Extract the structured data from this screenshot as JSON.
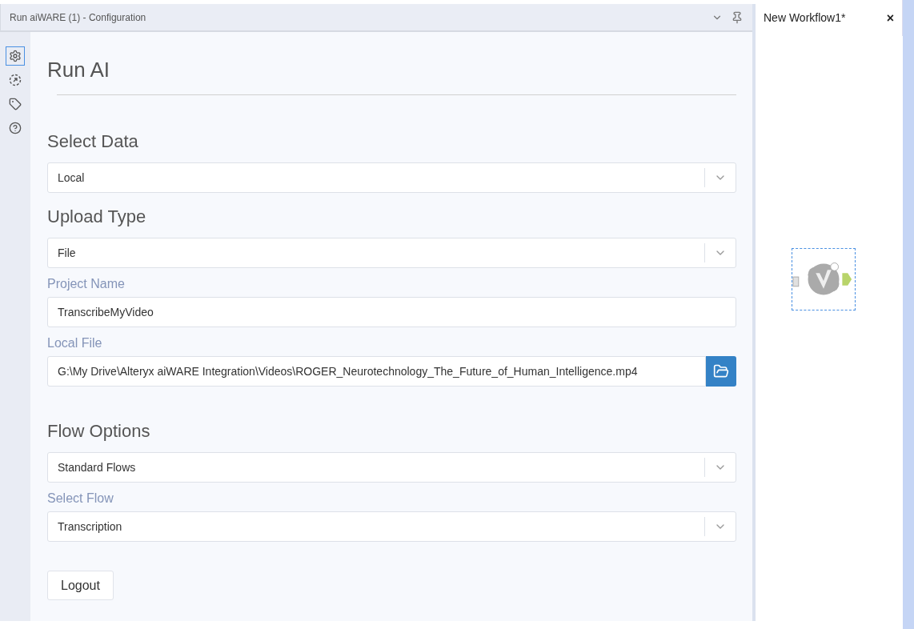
{
  "panel": {
    "title": "Run aiWARE (1) - Configuration"
  },
  "tool_tabs": [
    {
      "kind": "gear",
      "selected": true
    },
    {
      "kind": "connect",
      "selected": false
    },
    {
      "kind": "tag",
      "selected": false
    },
    {
      "kind": "help",
      "selected": false
    }
  ],
  "form": {
    "title": "Run AI",
    "items": [
      {
        "kind": "heading",
        "text": "Select Data"
      },
      {
        "kind": "select",
        "value": "Local"
      },
      {
        "kind": "heading",
        "text": "Upload Type"
      },
      {
        "kind": "select",
        "value": "File"
      },
      {
        "kind": "label",
        "text": "Project Name"
      },
      {
        "kind": "input",
        "value": "TranscribeMyVideo"
      },
      {
        "kind": "label",
        "text": "Local File"
      },
      {
        "kind": "file",
        "value": "G:\\My Drive\\Alteryx aiWARE Integration\\Videos\\ROGER_Neurotechnology_The_Future_of_Human_Intelligence.mp4"
      },
      {
        "kind": "heading",
        "text": "Flow Options"
      },
      {
        "kind": "select",
        "value": "Standard Flows"
      },
      {
        "kind": "label",
        "text": "Select Flow"
      },
      {
        "kind": "select",
        "value": "Transcription"
      },
      {
        "kind": "button",
        "text": "Logout"
      }
    ]
  },
  "workflow_tab": {
    "title": "New Workflow1*",
    "close": "×"
  }
}
